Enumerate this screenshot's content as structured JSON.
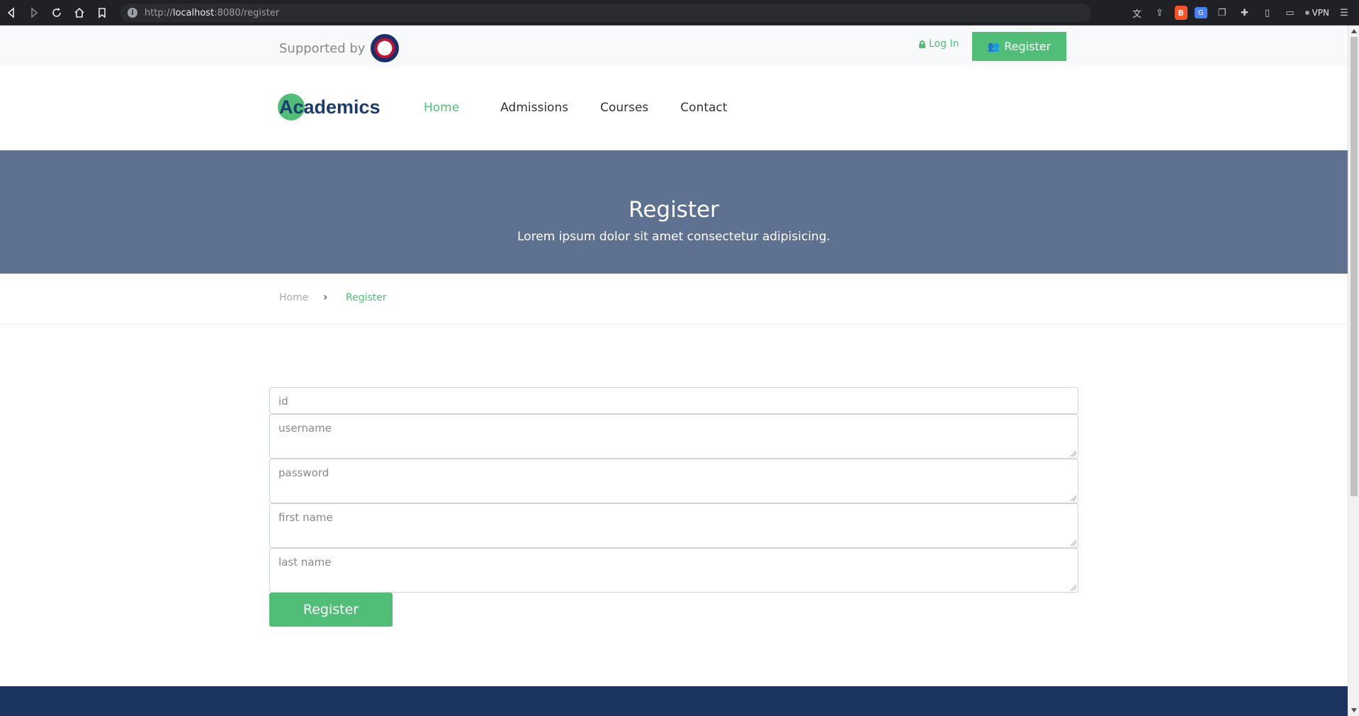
{
  "browser": {
    "url_prefix": "http://",
    "url_host": "localhost",
    "url_rest": ":8080/register",
    "vpn_label": "VPN"
  },
  "topbar": {
    "supported_label": "Supported by",
    "login_label": "Log In",
    "register_label": "Register"
  },
  "nav": {
    "logo": "Academics",
    "items": [
      {
        "label": "Home"
      },
      {
        "label": "Admissions"
      },
      {
        "label": "Courses"
      },
      {
        "label": "Contact"
      }
    ]
  },
  "hero": {
    "title": "Register",
    "subtitle": "Lorem ipsum dolor sit amet consectetur adipisicing."
  },
  "breadcrumb": {
    "home": "Home",
    "separator": "›",
    "current": "Register"
  },
  "form": {
    "fields": [
      {
        "placeholder": "id"
      },
      {
        "placeholder": "username"
      },
      {
        "placeholder": "password"
      },
      {
        "placeholder": "first name"
      },
      {
        "placeholder": "last name"
      }
    ],
    "submit_label": "Register"
  },
  "colors": {
    "accent": "#51be78",
    "hero_bg": "#5e7190",
    "footer_bg": "#1b3560",
    "logo": "#1b3d6e"
  }
}
